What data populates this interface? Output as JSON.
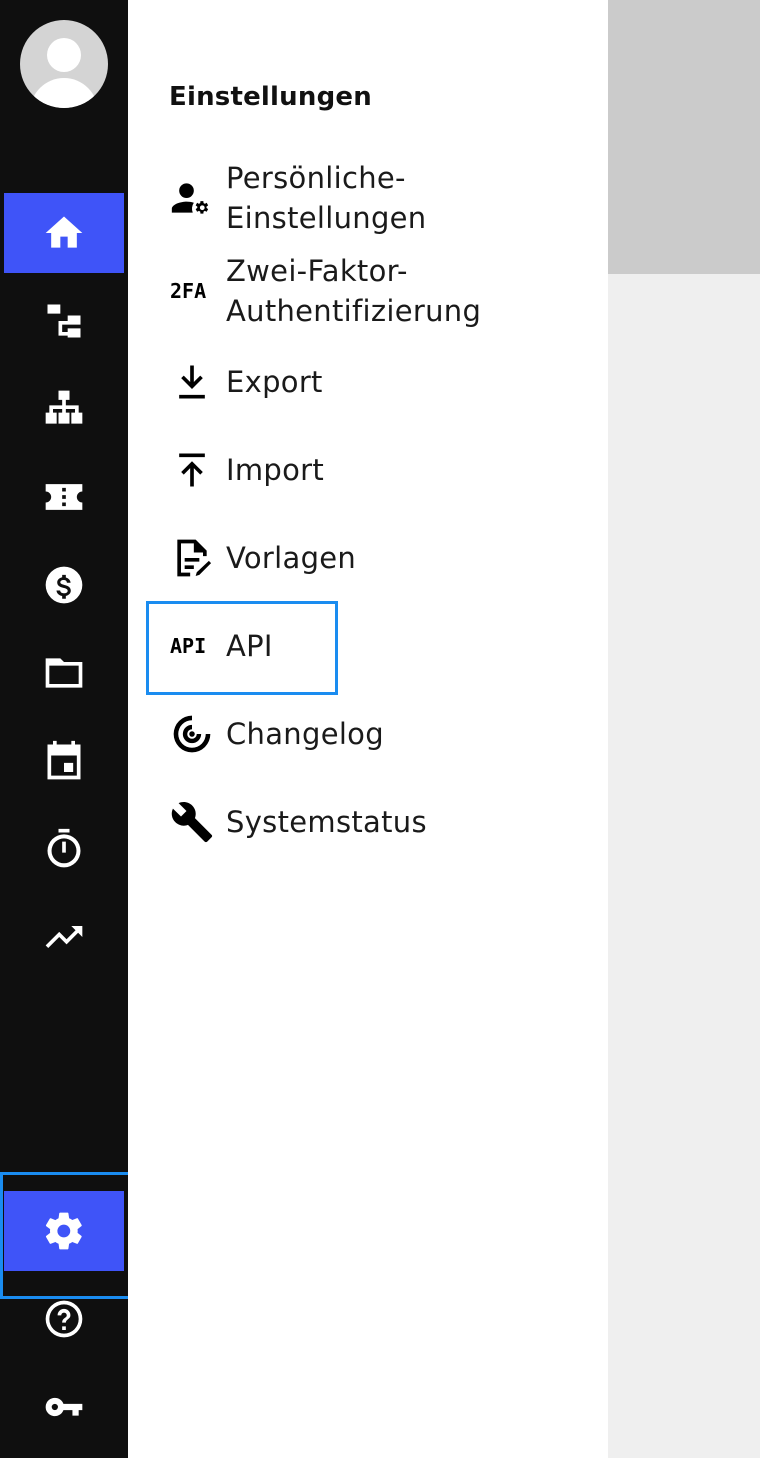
{
  "panel": {
    "title": "Einstellungen",
    "items": [
      {
        "label": "Persönliche-\nEinstellungen",
        "icon": "person-gear-icon"
      },
      {
        "label": "Zwei-Faktor-\nAuthentifizierung",
        "icon": "2fa-icon",
        "icon_text": "2FA"
      },
      {
        "label": "Export",
        "icon": "download-icon"
      },
      {
        "label": "Import",
        "icon": "upload-icon"
      },
      {
        "label": "Vorlagen",
        "icon": "edit-document-icon"
      },
      {
        "label": "API",
        "icon": "api-icon",
        "icon_text": "API"
      },
      {
        "label": "Changelog",
        "icon": "radar-icon"
      },
      {
        "label": "Systemstatus",
        "icon": "wrench-icon"
      }
    ]
  },
  "rail": {
    "items": [
      {
        "icon": "home-icon",
        "active": true
      },
      {
        "icon": "workflow-icon",
        "active": false
      },
      {
        "icon": "org-chart-icon",
        "active": false
      },
      {
        "icon": "ticket-icon",
        "active": false
      },
      {
        "icon": "dollar-icon",
        "active": false
      },
      {
        "icon": "folder-icon",
        "active": false
      },
      {
        "icon": "calendar-icon",
        "active": false
      },
      {
        "icon": "timer-icon",
        "active": false
      },
      {
        "icon": "trending-up-icon",
        "active": false
      },
      {
        "icon": "settings-gear-icon",
        "active": true
      },
      {
        "icon": "help-icon",
        "active": false
      },
      {
        "icon": "key-icon",
        "active": false
      }
    ]
  },
  "colors": {
    "rail_bg": "#0f0f0f",
    "active": "#3f54f8",
    "focus_ring": "#1a8cf0"
  }
}
